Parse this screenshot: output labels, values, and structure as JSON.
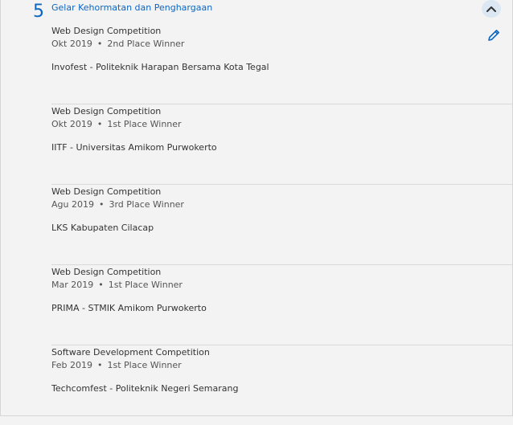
{
  "section": {
    "count": "5",
    "title": "Gelar Kehormatan dan Penghargaan"
  },
  "icons": {
    "collapse": "chevron-up-icon",
    "edit": "pencil-icon"
  },
  "colors": {
    "accent": "#0b66c2",
    "background": "#f3f3f3",
    "divider": "#d9d9d9"
  },
  "items": [
    {
      "title": "Web Design Competition",
      "date": "Okt 2019",
      "separator": "•",
      "award": "2nd Place Winner",
      "issuer": "Invofest - Politeknik Harapan Bersama Kota Tegal"
    },
    {
      "title": "Web Design Competition",
      "date": "Okt 2019",
      "separator": "•",
      "award": "1st Place Winner",
      "issuer": "IITF - Universitas Amikom Purwokerto"
    },
    {
      "title": "Web Design Competition",
      "date": "Agu 2019",
      "separator": "•",
      "award": "3rd Place Winner",
      "issuer": "LKS Kabupaten Cilacap"
    },
    {
      "title": "Web Design Competition",
      "date": "Mar 2019",
      "separator": "•",
      "award": "1st Place Winner",
      "issuer": "PRIMA - STMIK Amikom Purwokerto"
    },
    {
      "title": "Software Development Competition",
      "date": "Feb 2019",
      "separator": "•",
      "award": "1st Place Winner",
      "issuer": "Techcomfest - Politeknik Negeri Semarang"
    }
  ]
}
